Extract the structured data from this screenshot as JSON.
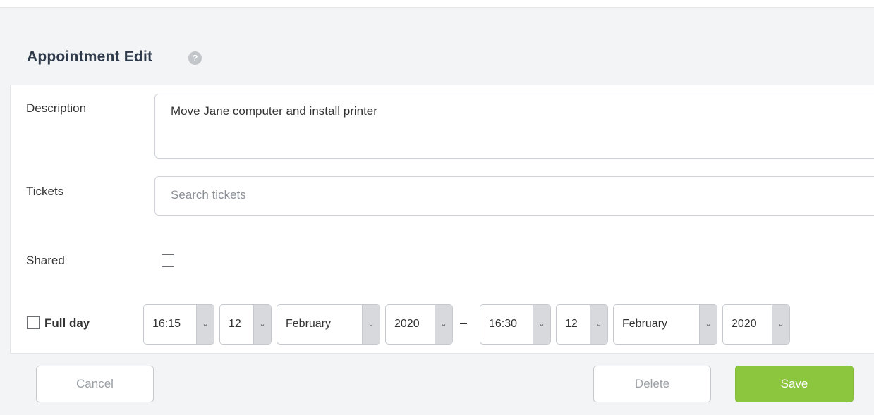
{
  "dialog": {
    "title": "Appointment Edit",
    "help_icon": "question-circle-icon"
  },
  "form": {
    "description_label": "Description",
    "description_value": "Move Jane computer and install printer",
    "tickets_label": "Tickets",
    "tickets_placeholder": "Search tickets",
    "tickets_value": "",
    "shared_label": "Shared",
    "shared_checked": false,
    "full_day_label": "Full day",
    "full_day_checked": false
  },
  "start": {
    "time": "16:15",
    "day": "12",
    "month": "February",
    "year": "2020"
  },
  "range_separator": "–",
  "end": {
    "time": "16:30",
    "day": "12",
    "month": "February",
    "year": "2020"
  },
  "buttons": {
    "cancel": "Cancel",
    "delete": "Delete",
    "save": "Save"
  },
  "icons": {
    "dropdown": "chevron-down-icon",
    "dropdown_glyph": "⌄"
  },
  "colors": {
    "save_bg": "#8cc63f",
    "title": "#2f3a4a",
    "background": "#f3f4f5"
  }
}
